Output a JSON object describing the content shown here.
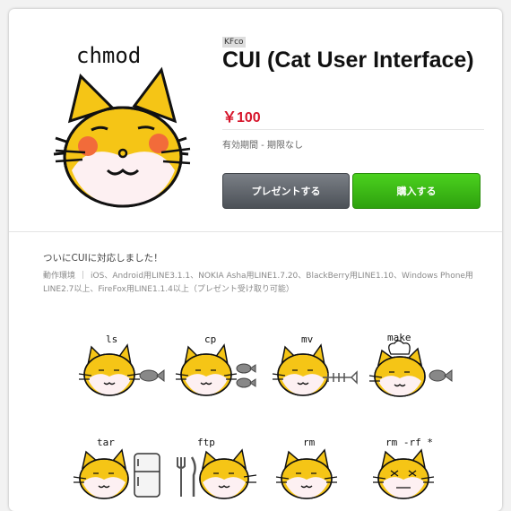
{
  "product": {
    "author": "KFco",
    "title": "CUI (Cat User Interface)",
    "price": "￥100",
    "validity": "有効期間 - 期限なし"
  },
  "cover": {
    "caption": "chmod"
  },
  "buttons": {
    "gift_label": "プレゼントする",
    "buy_label": "購入する"
  },
  "description": "ついにCUIに対応しました！",
  "environment": {
    "label": "動作環境",
    "text": "iOS、Android用LINE3.1.1、NOKIA Asha用LINE1.7.20、BlackBerry用LINE1.10、Windows Phone用LINE2.7以上、FireFox用LINE1.1.4以上（プレゼント受け取り可能）"
  },
  "stickers": [
    {
      "caption": "ls",
      "prop": "fish"
    },
    {
      "caption": "cp",
      "prop": "fish-pair"
    },
    {
      "caption": "mv",
      "prop": "fish-bone"
    },
    {
      "caption": "make",
      "prop": "chef-fish"
    },
    {
      "caption": "tar",
      "prop": "fridge"
    },
    {
      "caption": "ftp",
      "prop": "cutlery"
    },
    {
      "caption": "rm",
      "prop": "none"
    },
    {
      "caption": "rm -rf *",
      "prop": "none"
    }
  ],
  "colors": {
    "price": "#d6142a",
    "buy_button": "#3cb815",
    "gift_button": "#5b6066",
    "cat_fur": "#f5c516",
    "cheek": "#f26b3a"
  }
}
